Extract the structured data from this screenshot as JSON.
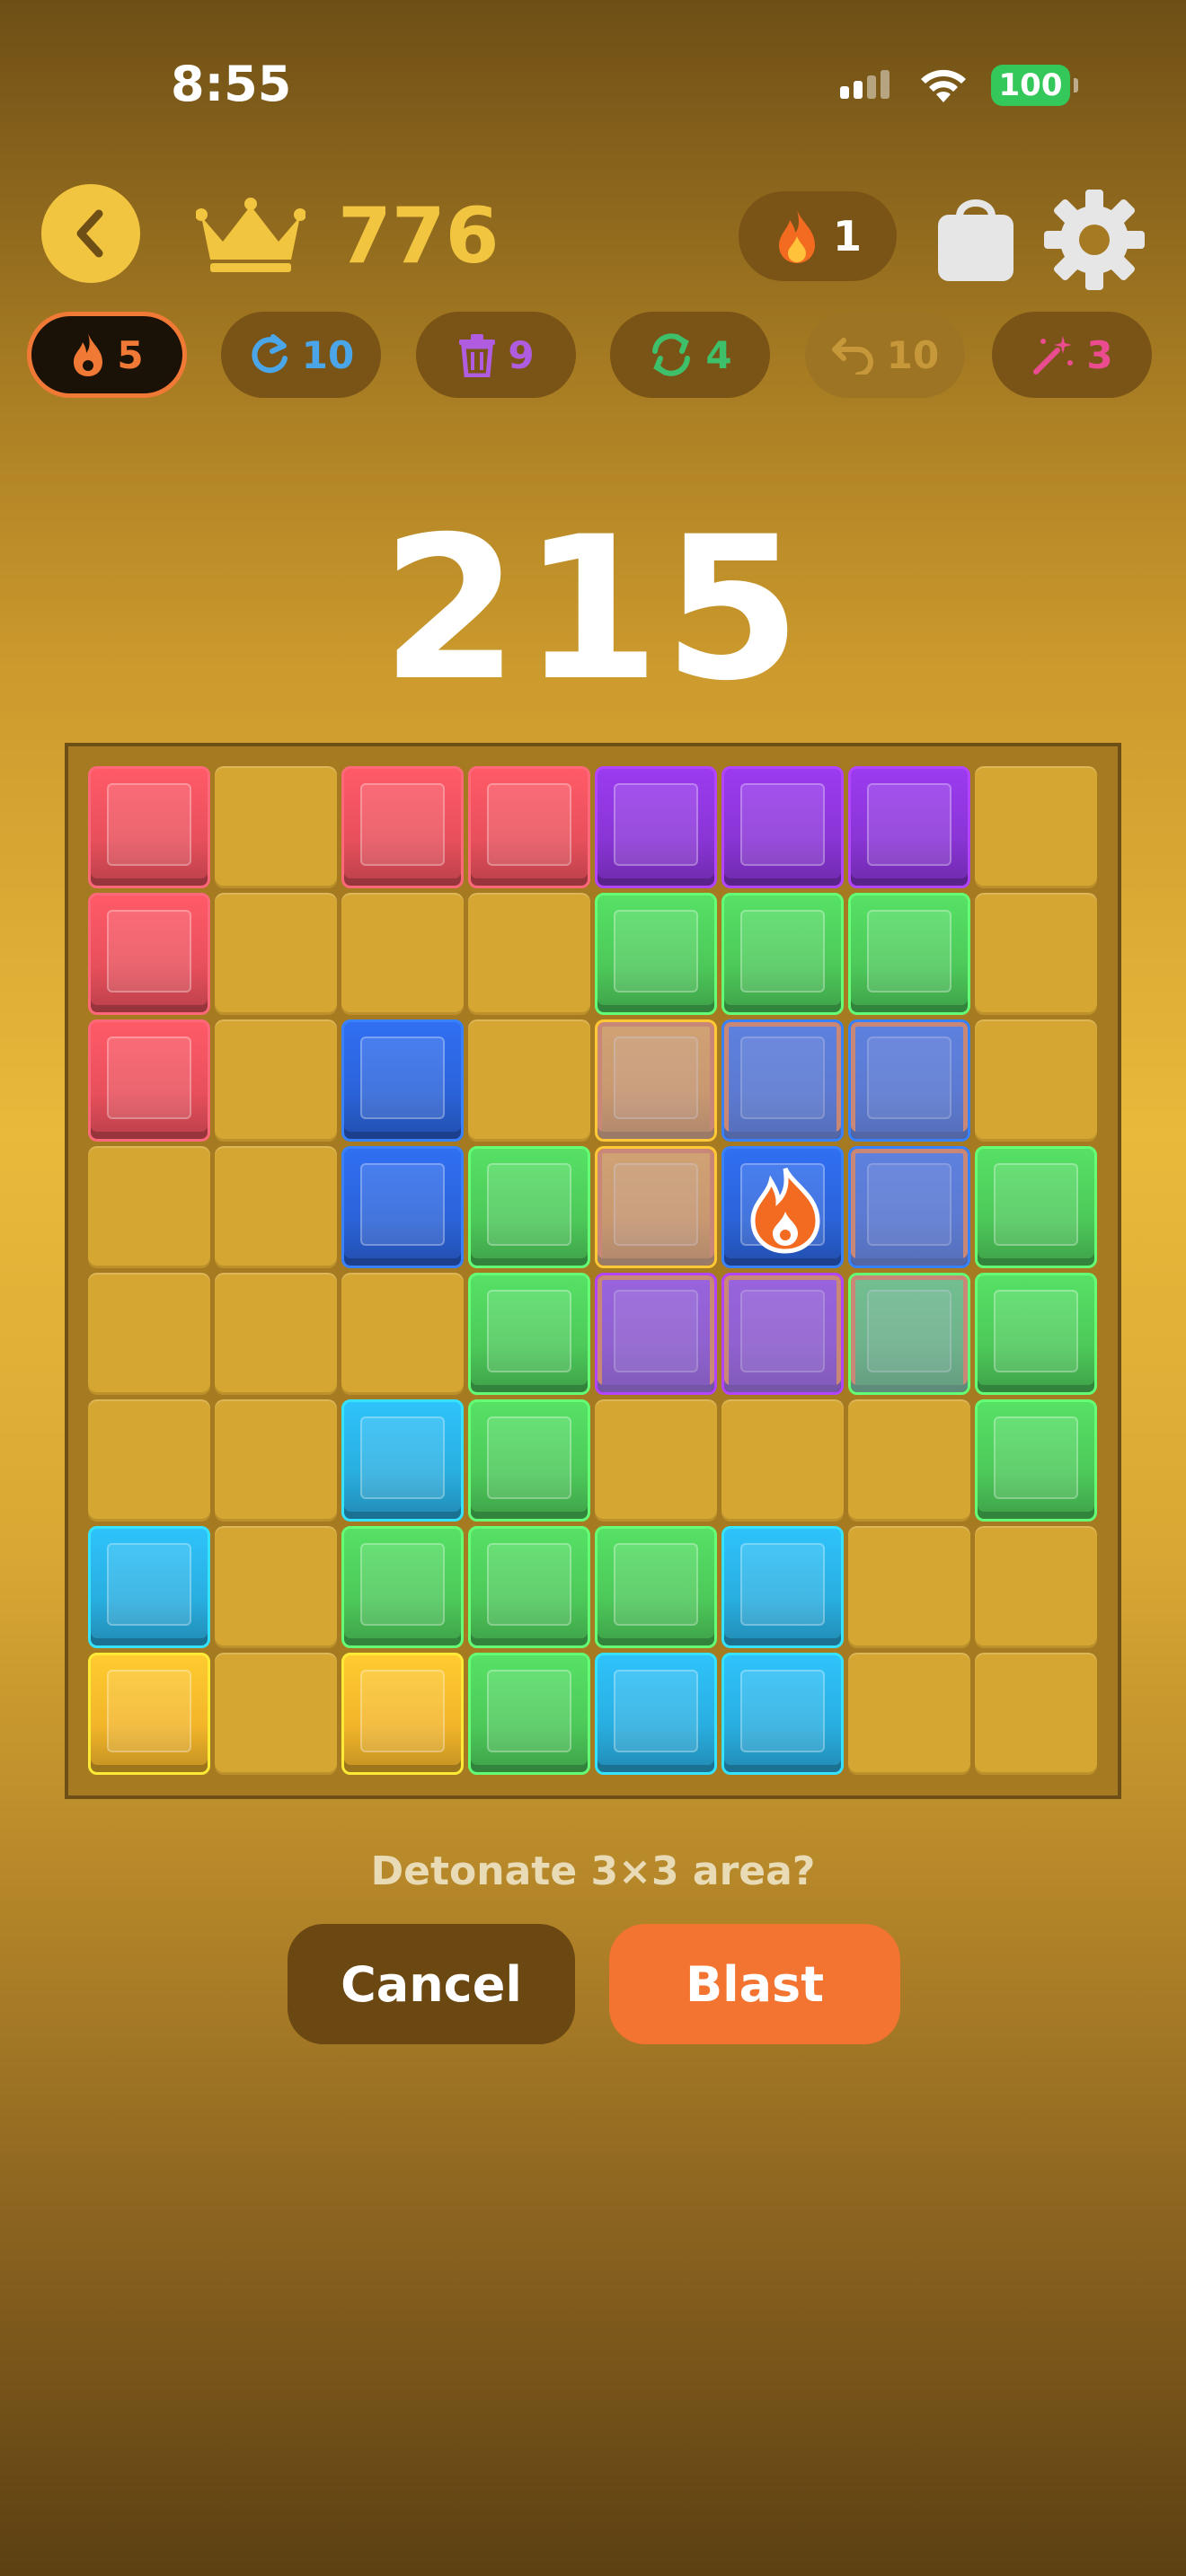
{
  "status_bar": {
    "time": "8:55",
    "battery": "100"
  },
  "header": {
    "best_score": "776",
    "streak_count": "1"
  },
  "powerups": [
    {
      "name": "bomb",
      "count": "5",
      "active": true,
      "color": "#f07a35"
    },
    {
      "name": "refresh",
      "count": "10",
      "active": false,
      "color": "#4aa6e8"
    },
    {
      "name": "trash",
      "count": "9",
      "active": false,
      "color": "#b05ce0"
    },
    {
      "name": "swap",
      "count": "4",
      "active": false,
      "color": "#3ec06a"
    },
    {
      "name": "undo",
      "count": "10",
      "active": false,
      "disabled": true,
      "color": "#c7983a"
    },
    {
      "name": "magic",
      "count": "3",
      "active": false,
      "color": "#ea4c8f"
    }
  ],
  "score": "215",
  "board": {
    "size": 8,
    "colors": {
      "red": "#e8505c",
      "purple": "#8a35d6",
      "green": "#4dc95a",
      "blue": "#2b63d9",
      "orange": "#f29a2a",
      "cyan": "#29aee0",
      "yellow": "#f2b52a"
    },
    "grid": [
      [
        "red",
        null,
        "red",
        "red",
        "purple",
        "purple",
        "purple",
        null
      ],
      [
        "red",
        null,
        null,
        null,
        "green",
        "green",
        "green",
        null
      ],
      [
        "red",
        null,
        "blue",
        null,
        "orange",
        "blue",
        "blue",
        null
      ],
      [
        null,
        null,
        "blue",
        "green",
        "orange",
        "blue",
        "blue",
        "green"
      ],
      [
        null,
        null,
        null,
        "green",
        "purple",
        "purple",
        "green",
        "green"
      ],
      [
        null,
        null,
        "cyan",
        "green",
        null,
        null,
        null,
        "green"
      ],
      [
        "cyan",
        null,
        "green",
        "green",
        "green",
        "cyan",
        null,
        null
      ],
      [
        "yellow",
        null,
        "yellow",
        "green",
        "cyan",
        "cyan",
        null,
        null
      ]
    ],
    "blast_center": [
      3,
      5
    ],
    "blast_radius": 1
  },
  "prompt": "Detonate 3×3 area?",
  "buttons": {
    "cancel": "Cancel",
    "blast": "Blast"
  }
}
